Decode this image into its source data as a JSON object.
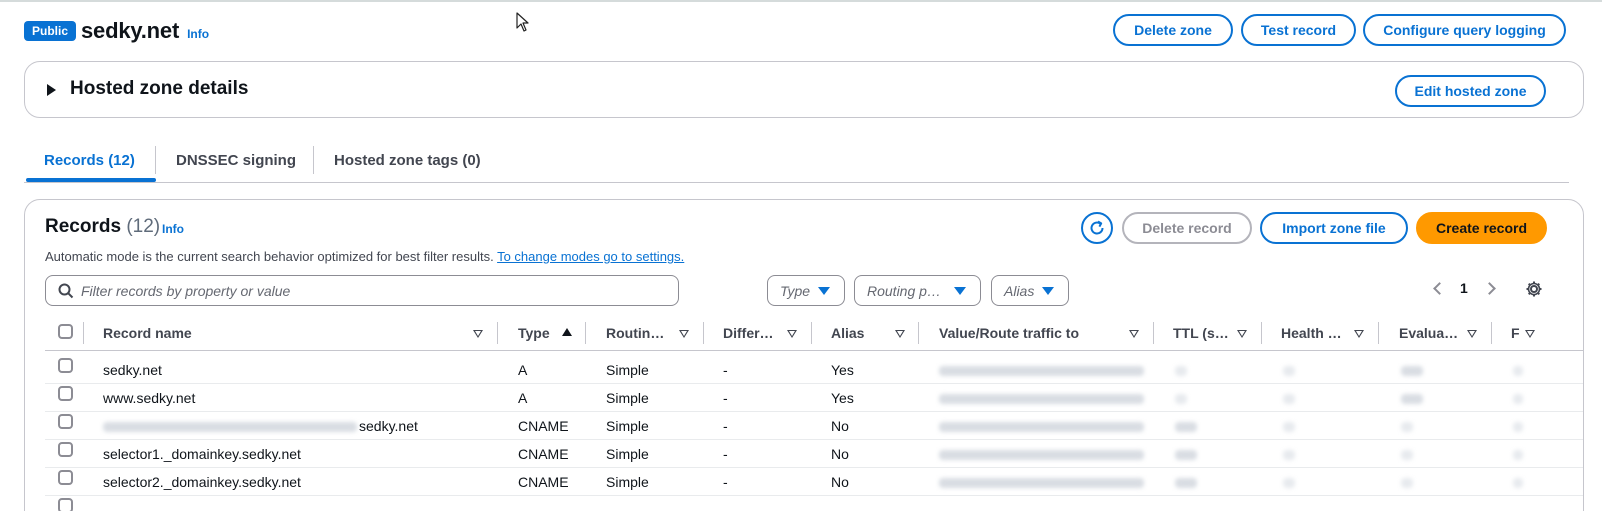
{
  "header": {
    "badge": "Public",
    "zone_name": "sedky.net",
    "info": "Info",
    "buttons": {
      "delete_zone": "Delete zone",
      "test_record": "Test record",
      "configure_logging": "Configure query logging"
    }
  },
  "details": {
    "title": "Hosted zone details",
    "edit_button": "Edit hosted zone"
  },
  "tabs": [
    {
      "label": "Records (12)",
      "active": true
    },
    {
      "label": "DNSSEC signing",
      "active": false
    },
    {
      "label": "Hosted zone tags (0)",
      "active": false
    }
  ],
  "records": {
    "title": "Records",
    "count": "(12)",
    "info": "Info",
    "description": "Automatic mode is the current search behavior optimized for best filter results.",
    "settings_link": "To change modes go to settings.",
    "buttons": {
      "delete": "Delete record",
      "import": "Import zone file",
      "create": "Create record"
    },
    "search_placeholder": "Filter records by property or value",
    "filters": {
      "type": "Type",
      "routing": "Routing p…",
      "alias": "Alias"
    },
    "page": "1",
    "columns": [
      "Record name",
      "Type",
      "Routin…",
      "Differ…",
      "Alias",
      "Value/Route traffic to",
      "TTL (s…",
      "Health …",
      "Evalua…",
      "F"
    ],
    "rows": [
      {
        "name_prefix": "",
        "name": "sedky.net",
        "type": "A",
        "routing": "Simple",
        "differ": "-",
        "alias": "Yes"
      },
      {
        "name_prefix": "",
        "name": "www.sedky.net",
        "type": "A",
        "routing": "Simple",
        "differ": "-",
        "alias": "Yes"
      },
      {
        "name_prefix": "blurred",
        "name": "sedky.net",
        "type": "CNAME",
        "routing": "Simple",
        "differ": "-",
        "alias": "No"
      },
      {
        "name_prefix": "",
        "name": "selector1._domainkey.sedky.net",
        "type": "CNAME",
        "routing": "Simple",
        "differ": "-",
        "alias": "No"
      },
      {
        "name_prefix": "",
        "name": "selector2._domainkey.sedky.net",
        "type": "CNAME",
        "routing": "Simple",
        "differ": "-",
        "alias": "No"
      }
    ]
  },
  "colors": {
    "accent": "#0972d3",
    "primary": "#ff9900",
    "border": "#c6c6cd"
  }
}
